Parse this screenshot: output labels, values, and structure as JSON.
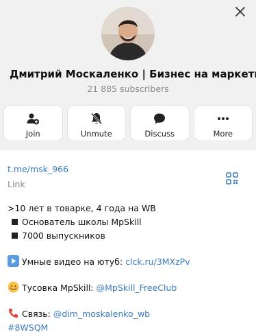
{
  "channel": {
    "title": "Дмитрий Москаленко | Бизнес на маркетплей...",
    "subscribers": "21 885 subscribers"
  },
  "actions": [
    {
      "label": "Join",
      "icon": "add-user-icon"
    },
    {
      "label": "Unmute",
      "icon": "bell-off-icon"
    },
    {
      "label": "Discuss",
      "icon": "chat-bubble-icon"
    },
    {
      "label": "More",
      "icon": "more-dots-icon"
    }
  ],
  "info": {
    "username": "t.me/msk_966",
    "username_label": "Link"
  },
  "description": {
    "line1": ">10 лет в товарке, 4 года на WB",
    "line2": "Основатель школы MpSkill",
    "line3": "7000 выпускников",
    "video_text": "Умные видео на ютуб: ",
    "video_link": "clck.ru/3MXzPv",
    "club_text": "Тусовка MpSkill: ",
    "club_link": "@MpSkill_FreeClub",
    "contact_text": "Связь: ",
    "contact_link": "@dim_moskalenko_wb",
    "hashtag": "#8WSQM"
  },
  "colors": {
    "link": "#3a7cc3",
    "header_bg": "#f1f1f1",
    "muted": "#8a8a8a"
  }
}
